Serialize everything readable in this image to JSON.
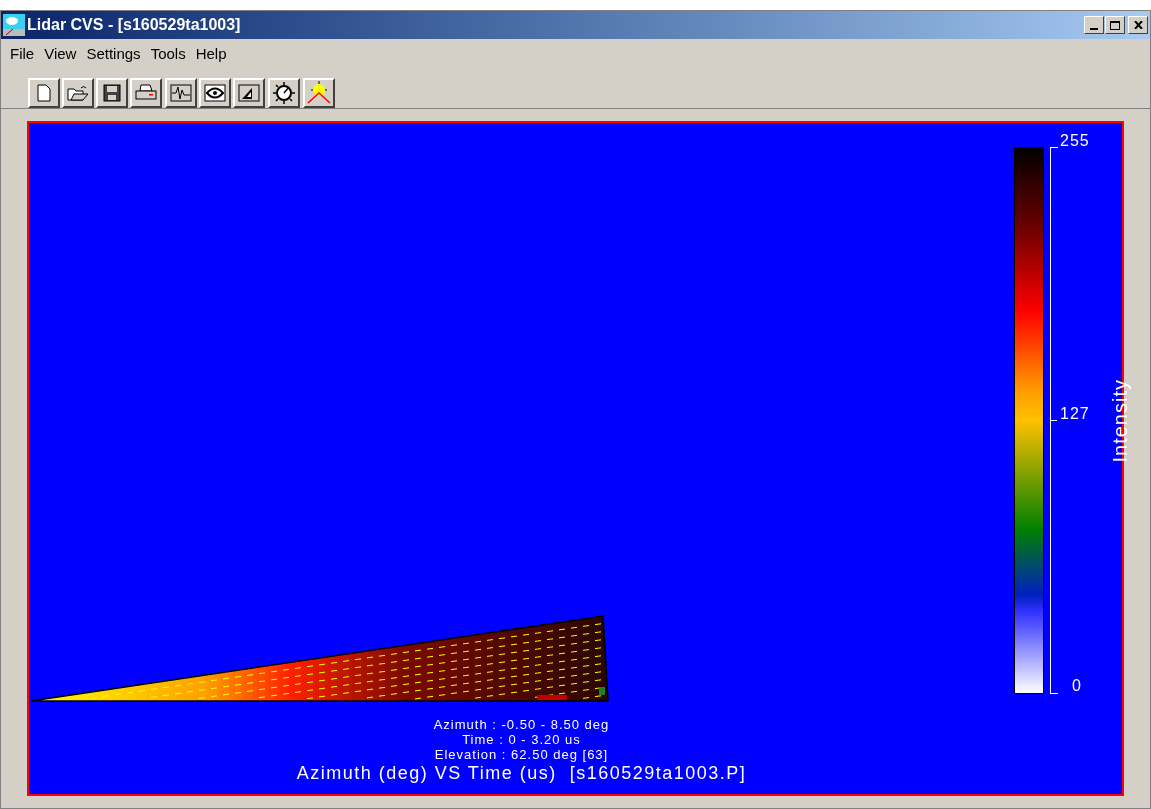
{
  "window": {
    "title": "Lidar CVS - [s160529ta1003]"
  },
  "menu": [
    {
      "label": "File"
    },
    {
      "label": "View"
    },
    {
      "label": "Settings"
    },
    {
      "label": "Tools"
    },
    {
      "label": "Help"
    }
  ],
  "plot": {
    "info_lines": [
      "Azimuth : -0.50 - 8.50 deg",
      "Time : 0 - 3.20 us",
      "Elevation : 62.50 deg [63]"
    ],
    "title": "Azimuth (deg) VS Time (us)  [s160529ta1003.P]",
    "colorbar": {
      "label": "Intensity",
      "ticks": [
        "255",
        "127",
        "0"
      ]
    }
  }
}
